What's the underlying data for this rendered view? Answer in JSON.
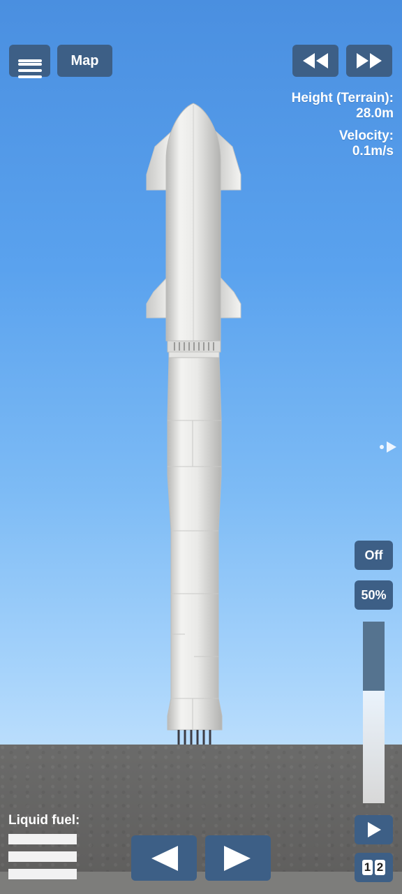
{
  "top_left": {
    "map_label": "Map",
    "menu_icon": "hamburger-menu-icon"
  },
  "top_right": {
    "rewind_icon": "rewind-icon",
    "fast_forward_icon": "fast-forward-icon"
  },
  "telemetry": {
    "height_label": "Height (Terrain):",
    "height_value": "28.0m",
    "velocity_label": "Velocity:",
    "velocity_value": "0.1m/s"
  },
  "side_controls": {
    "toggle_label": "Off",
    "throttle_label": "50%",
    "throttle_level": 0.62,
    "expand_icon": "arrow-right-icon"
  },
  "fuel": {
    "label": "Liquid fuel:",
    "bar_count": 3
  },
  "bottom_controls": {
    "rotate_left_icon": "triangle-left-icon",
    "rotate_right_icon": "triangle-right-icon",
    "stage_icon": "play-icon",
    "stage_numbers": [
      "1",
      "2"
    ]
  },
  "colors": {
    "button": "#3d5f86",
    "sky_top": "#4a8fe0",
    "sky_bottom": "#b9ddfc",
    "ground": "#666665",
    "rocket": "#e6e6e4"
  }
}
